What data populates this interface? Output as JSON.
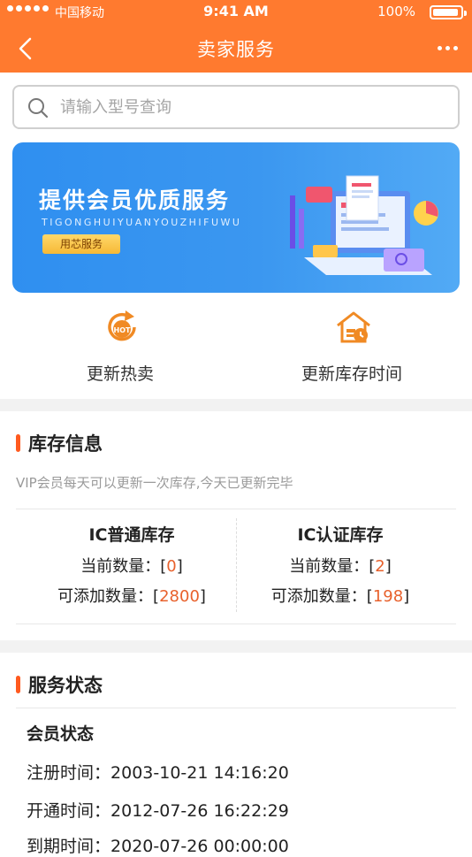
{
  "status_bar": {
    "carrier": "中国移动",
    "time": "9:41 AM",
    "battery": "100%"
  },
  "nav": {
    "title": "卖家服务"
  },
  "search": {
    "placeholder": "请输入型号查询"
  },
  "banner": {
    "title": "提供会员优质服务",
    "subtitle": "TIGONGHUIYUANYOUZHIFUWU",
    "tag": "用芯服务"
  },
  "quick_actions": [
    {
      "label": "更新热卖",
      "icon": "hot-refresh-icon",
      "badge": "HOT"
    },
    {
      "label": "更新库存时间",
      "icon": "warehouse-clock-icon"
    }
  ],
  "inventory": {
    "title": "库存信息",
    "notice": "VIP会员每天可以更新一次库存,今天已更新完毕",
    "columns": [
      {
        "title": "IC普通库存",
        "current_label": "当前数量：[",
        "current": "0",
        "addable_label": "可添加数量：[",
        "addable": "2800"
      },
      {
        "title": "IC认证库存",
        "current_label": "当前数量：[",
        "current": "2",
        "addable_label": "可添加数量：[",
        "addable": "198"
      }
    ],
    "close_bracket": "]"
  },
  "service": {
    "title": "服务状态",
    "sub_title": "会员状态",
    "rows": [
      {
        "label": "注册时间：",
        "value": "2003-10-21 14:16:20"
      },
      {
        "label": "开通时间：",
        "value": "2012-07-26 16:22:29"
      },
      {
        "label": "到期时间：",
        "value": "2020-07-26 00:00:00"
      }
    ]
  },
  "colors": {
    "brand": "#ff7a2f",
    "accent": "#ff5a1f",
    "number": "#e8612c",
    "banner": "#3b97f0"
  }
}
